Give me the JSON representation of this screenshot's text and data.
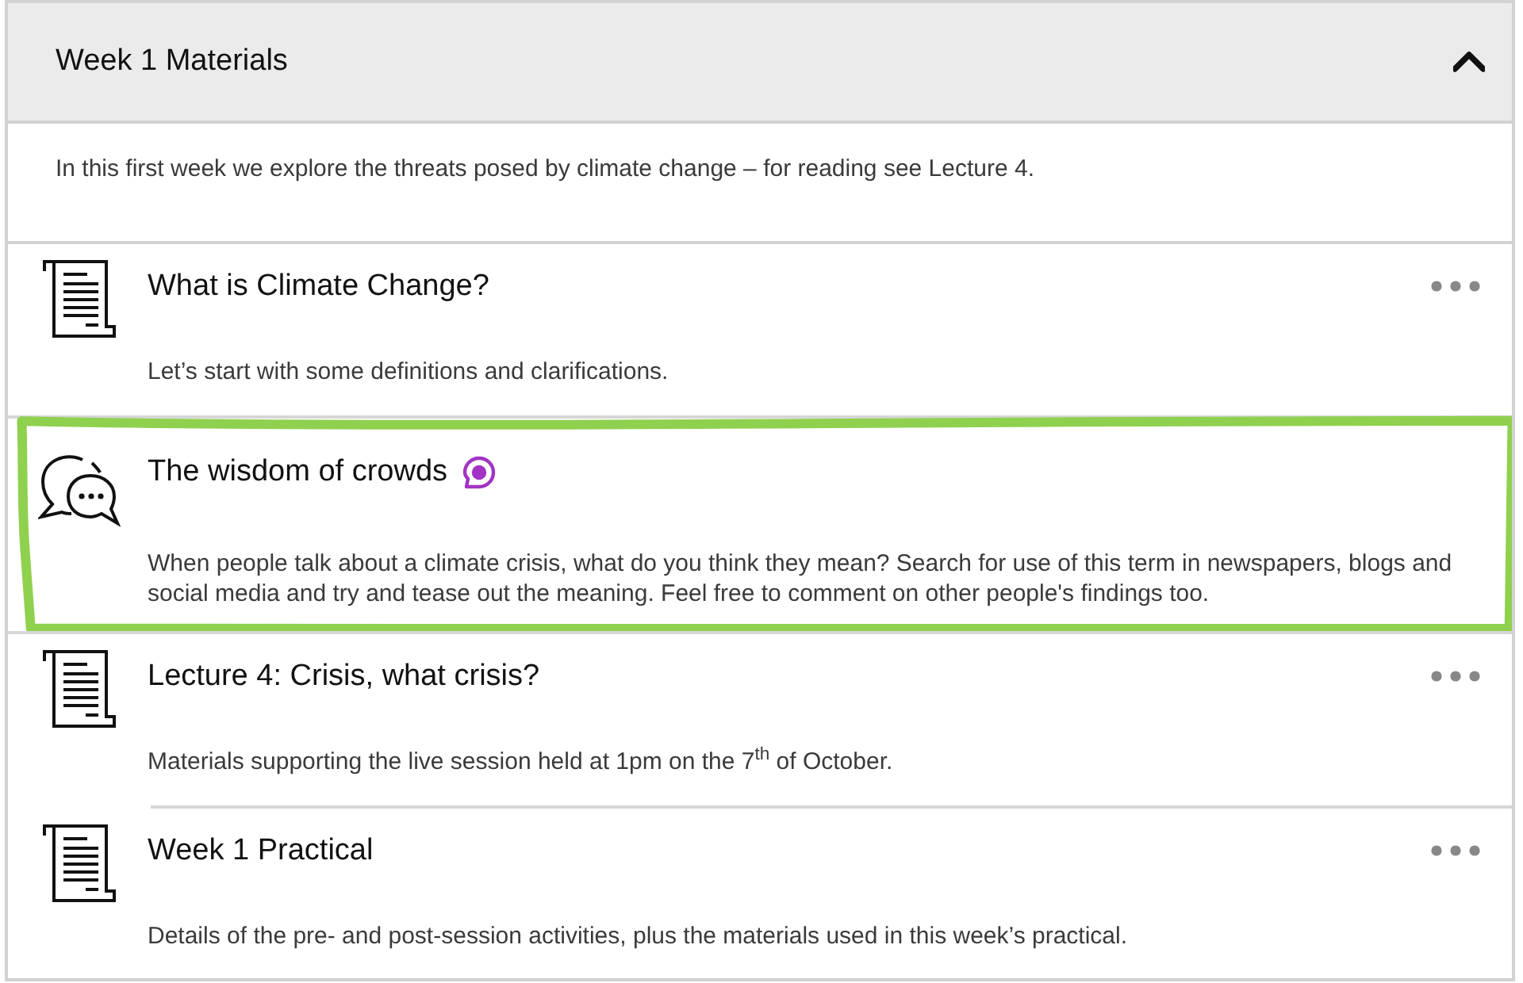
{
  "section": {
    "title": "Week 1 Materials",
    "expanded": true,
    "description": "In this first week we explore the threats posed by climate change – for reading see Lecture 4."
  },
  "items": [
    {
      "kind": "document",
      "title": "What is Climate Change?",
      "badge": false,
      "menu": true,
      "highlighted": false,
      "description": "Let’s start with some definitions and clarifications."
    },
    {
      "kind": "discussion",
      "title": "The wisdom of crowds",
      "badge": true,
      "menu": false,
      "highlighted": true,
      "description": "When people talk about a climate crisis, what do you think they mean? Search for use of this term in newspapers, blogs and social media and try and tease out the meaning. Feel free to comment on other people's findings too."
    },
    {
      "kind": "document",
      "title": "Lecture 4: Crisis, what crisis?",
      "badge": false,
      "menu": true,
      "highlighted": false,
      "description": "Materials supporting the live session held at 1pm on the 7$^{th}$ of October."
    },
    {
      "kind": "document",
      "title": "Week 1 Practical",
      "badge": false,
      "menu": true,
      "highlighted": false,
      "description": "Details of the pre- and post-session activities, plus the materials used in this week’s practical."
    }
  ]
}
